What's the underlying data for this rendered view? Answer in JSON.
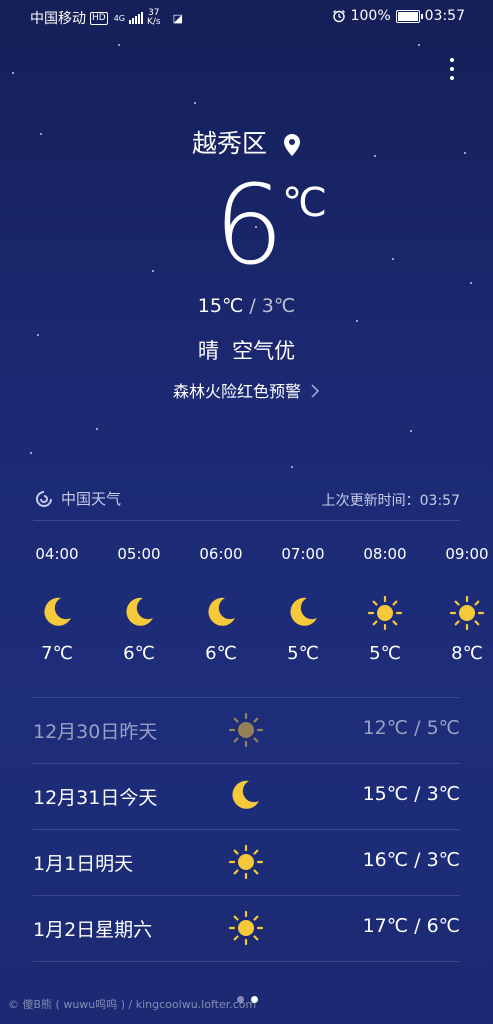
{
  "status_bar": {
    "carrier": "中国移动",
    "hd": "HD",
    "network": "4G",
    "speed_value": "37",
    "speed_unit": "K/s",
    "battery": "100%",
    "time": "03:57"
  },
  "header": {
    "location": "越秀区",
    "current_temp": "6",
    "unit": "℃",
    "high": "15℃",
    "low": "3℃",
    "range_sep": " / ",
    "weather": "晴",
    "air_quality": "空气优",
    "warning": "森林火险红色预警"
  },
  "source": {
    "name": "中国天气",
    "updated_label": "上次更新时间：",
    "updated_time": "03:57"
  },
  "hourly": [
    {
      "time": "04:00",
      "icon": "moon-icon",
      "temp": "7℃"
    },
    {
      "time": "05:00",
      "icon": "moon-icon",
      "temp": "6℃"
    },
    {
      "time": "06:00",
      "icon": "moon-icon",
      "temp": "6℃"
    },
    {
      "time": "07:00",
      "icon": "moon-icon",
      "temp": "5℃"
    },
    {
      "time": "08:00",
      "icon": "sun-icon",
      "temp": "5℃"
    },
    {
      "time": "09:00",
      "icon": "sun-icon",
      "temp": "8℃"
    }
  ],
  "daily": [
    {
      "date": "12月30日昨天",
      "icon": "sun-icon",
      "range": "12℃ / 5℃"
    },
    {
      "date": "12月31日今天",
      "icon": "moon-icon",
      "range": "15℃ / 3℃"
    },
    {
      "date": "1月1日明天",
      "icon": "sun-icon",
      "range": "16℃ / 3℃"
    },
    {
      "date": "1月2日星期六",
      "icon": "sun-icon",
      "range": "17℃ / 6℃"
    }
  ],
  "watermark": "© 傻B熊 ( wuwu呜呜 ) / kingcoolwu.lofter.com",
  "colors": {
    "moon": "#f5c93a",
    "sun": "#f5c93a",
    "sun_dim": "#b89a4a"
  }
}
